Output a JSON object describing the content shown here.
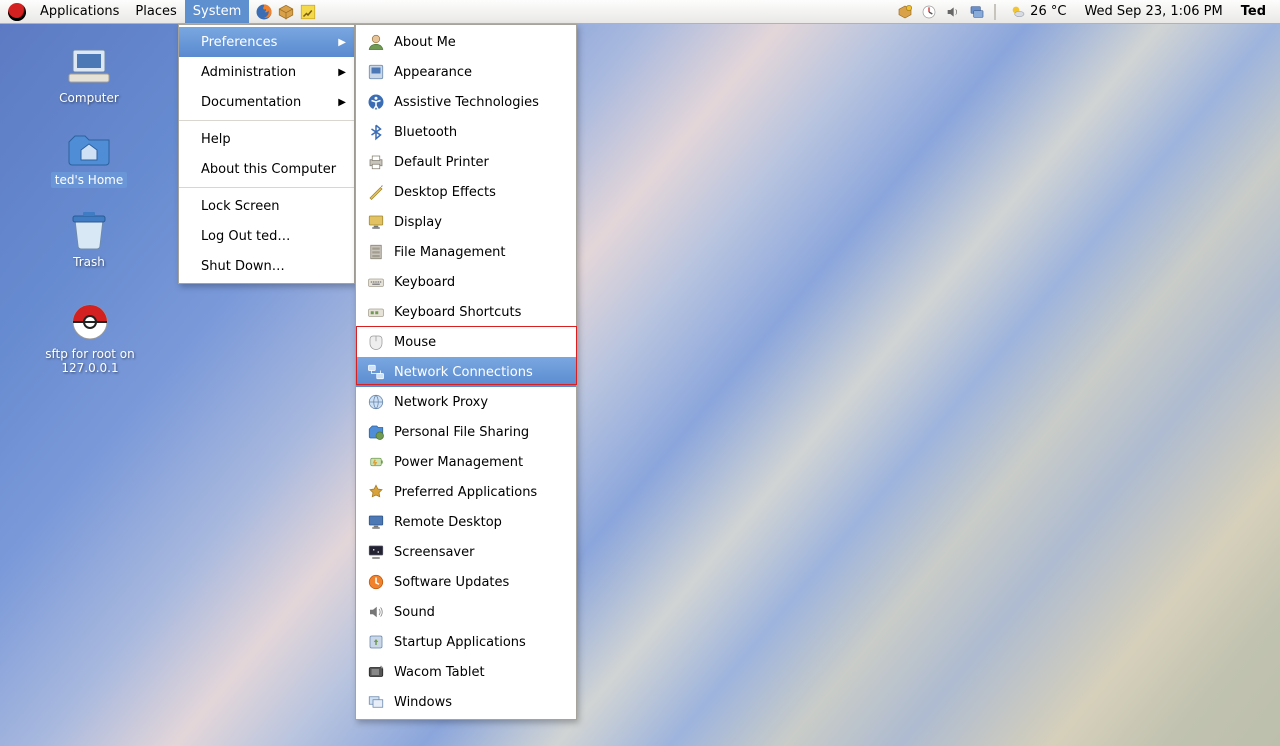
{
  "panel": {
    "menus": {
      "applications": "Applications",
      "places": "Places",
      "system": "System"
    },
    "weather": {
      "temp": "26 °C"
    },
    "clock": "Wed Sep 23,  1:06 PM",
    "user": "Ted"
  },
  "desktop": {
    "computer": "Computer",
    "home": "ted's Home",
    "trash": "Trash",
    "sftp": "sftp for root on 127.0.0.1"
  },
  "system_menu": {
    "preferences": "Preferences",
    "administration": "Administration",
    "documentation": "Documentation",
    "help": "Help",
    "about": "About this Computer",
    "lock": "Lock Screen",
    "logout": "Log Out ted…",
    "shutdown": "Shut Down…"
  },
  "prefs": {
    "about_me": "About Me",
    "appearance": "Appearance",
    "assistive": "Assistive Technologies",
    "bluetooth": "Bluetooth",
    "printer": "Default Printer",
    "effects": "Desktop Effects",
    "display": "Display",
    "filemgmt": "File Management",
    "keyboard": "Keyboard",
    "shortcuts": "Keyboard Shortcuts",
    "mouse": "Mouse",
    "netconn": "Network Connections",
    "proxy": "Network Proxy",
    "fileshare": "Personal File Sharing",
    "power": "Power Management",
    "prefapps": "Preferred Applications",
    "remote": "Remote Desktop",
    "screensaver": "Screensaver",
    "updates": "Software Updates",
    "sound": "Sound",
    "startup": "Startup Applications",
    "wacom": "Wacom Tablet",
    "windows": "Windows"
  }
}
